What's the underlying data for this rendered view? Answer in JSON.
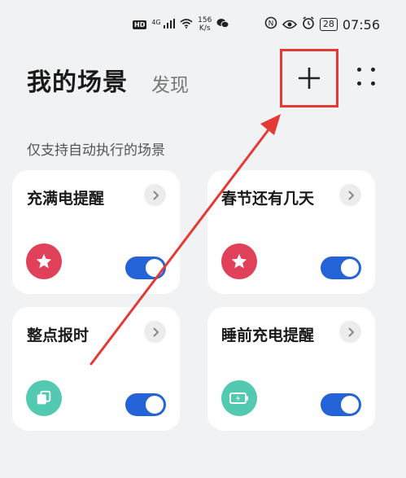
{
  "status_bar": {
    "hd_label": "HD",
    "signal_label": "4G",
    "net_speed_value": "156",
    "net_speed_unit": "K/s",
    "battery": "28",
    "time": "07:56"
  },
  "header": {
    "title": "我的场景",
    "discover_tab": "发现"
  },
  "section_title": "仅支持自动执行的场景",
  "cards": [
    {
      "title": "充满电提醒",
      "icon": "star-icon",
      "icon_color": "#e0405a",
      "enabled": true
    },
    {
      "title": "春节还有几天",
      "icon": "star-icon",
      "icon_color": "#e0405a",
      "enabled": true
    },
    {
      "title": "整点报时",
      "icon": "copy-icon",
      "icon_color": "#52c9b0",
      "enabled": true
    },
    {
      "title": "睡前充电提醒",
      "icon": "battery-charging-icon",
      "icon_color": "#52c9b0",
      "enabled": true
    }
  ],
  "colors": {
    "annotation_red": "#e53935",
    "toggle_blue": "#2563d9",
    "background": "#f1f2f4"
  }
}
